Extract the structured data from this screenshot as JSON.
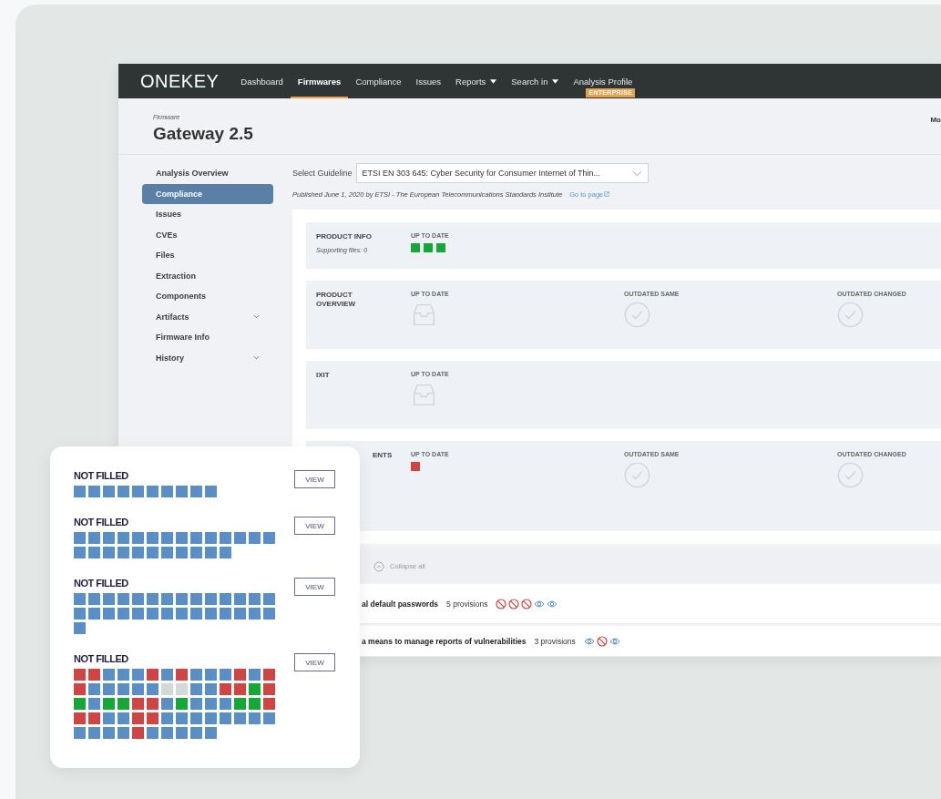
{
  "nav": {
    "logo": "ONEKEY",
    "items": [
      {
        "label": "Dashboard",
        "selected": false,
        "dropdown": false
      },
      {
        "label": "Firmwares",
        "selected": true,
        "dropdown": false
      },
      {
        "label": "Compliance",
        "selected": false,
        "dropdown": false
      },
      {
        "label": "Issues",
        "selected": false,
        "dropdown": false
      },
      {
        "label": "Reports",
        "selected": false,
        "dropdown": true
      },
      {
        "label": "Search in",
        "selected": false,
        "dropdown": true
      },
      {
        "label": "Analysis Profile",
        "selected": false,
        "dropdown": false,
        "badge": "ENTERPRISE"
      }
    ]
  },
  "header": {
    "caption": "Firmware",
    "title": "Gateway 2.5",
    "right_label": "Mo"
  },
  "sidebar": {
    "items": [
      {
        "label": "Analysis Overview",
        "selected": false,
        "expandable": false
      },
      {
        "label": "Compliance",
        "selected": true,
        "expandable": false
      },
      {
        "label": "Issues",
        "selected": false,
        "expandable": false
      },
      {
        "label": "CVEs",
        "selected": false,
        "expandable": false
      },
      {
        "label": "Files",
        "selected": false,
        "expandable": false
      },
      {
        "label": "Extraction",
        "selected": false,
        "expandable": false
      },
      {
        "label": "Components",
        "selected": false,
        "expandable": false
      },
      {
        "label": "Artifacts",
        "selected": false,
        "expandable": true
      },
      {
        "label": "Firmware Info",
        "selected": false,
        "expandable": false
      },
      {
        "label": "History",
        "selected": false,
        "expandable": true
      }
    ]
  },
  "guideline": {
    "label": "Select Guideline",
    "value": "ETSI EN 303 645: Cyber Security for Consumer Internet of Thin...",
    "published": "Published June 1, 2020 by ETSI - The European Telecommunications Standards Institute",
    "link": "Go to page"
  },
  "sections": [
    {
      "label": "PRODUCT INFO",
      "note": "Supporting files: 0",
      "columns": [
        {
          "label": "UP TO DATE",
          "kind": "squares",
          "cells": [
            {
              "color": "#16a836"
            },
            {
              "color": "#16a836"
            },
            {
              "color": "#16a836"
            }
          ]
        }
      ]
    },
    {
      "label": "PRODUCT OVERVIEW",
      "columns": [
        {
          "label": "UP TO DATE",
          "kind": "empty"
        },
        {
          "label": "OUTDATED SAME",
          "kind": "check"
        },
        {
          "label": "OUTDATED CHANGED",
          "kind": "check"
        }
      ]
    },
    {
      "label": "IXIT",
      "columns": [
        {
          "label": "UP TO DATE",
          "kind": "empty"
        }
      ]
    },
    {
      "label": "ENTS",
      "columns": [
        {
          "label": "UP TO DATE",
          "kind": "squares",
          "cells": [
            {
              "color": "#d14444"
            }
          ]
        },
        {
          "label": "OUTDATED SAME",
          "kind": "check"
        },
        {
          "label": "OUTDATED CHANGED",
          "kind": "check"
        }
      ]
    }
  ],
  "collapse": {
    "label": "Collapse all"
  },
  "provisions": [
    {
      "title": "al default passwords",
      "count": "5 provisions",
      "marks": [
        {
          "kind": "blocked"
        },
        {
          "kind": "blocked"
        },
        {
          "kind": "blocked"
        },
        {
          "kind": "visible"
        },
        {
          "kind": "visible"
        }
      ]
    },
    {
      "title": "a means to manage reports of vulnerabilities",
      "count": "3 provisions",
      "marks": [
        {
          "kind": "visible"
        },
        {
          "kind": "blocked"
        },
        {
          "kind": "visible"
        }
      ]
    }
  ],
  "overlay": {
    "groups": [
      {
        "title": "NOT FILLED",
        "button": "VIEW",
        "cells": [
          {
            "color": "#5a8fc6"
          },
          {
            "color": "#5a8fc6"
          },
          {
            "color": "#5a8fc6"
          },
          {
            "color": "#5a8fc6"
          },
          {
            "color": "#5a8fc6"
          },
          {
            "color": "#5a8fc6"
          },
          {
            "color": "#5a8fc6"
          },
          {
            "color": "#5a8fc6"
          },
          {
            "color": "#5a8fc6"
          },
          {
            "color": "#5a8fc6"
          }
        ]
      },
      {
        "title": "NOT FILLED",
        "button": "VIEW",
        "cells": [
          {
            "color": "#5a8fc6"
          },
          {
            "color": "#5a8fc6"
          },
          {
            "color": "#5a8fc6"
          },
          {
            "color": "#5a8fc6"
          },
          {
            "color": "#5a8fc6"
          },
          {
            "color": "#5a8fc6"
          },
          {
            "color": "#5a8fc6"
          },
          {
            "color": "#5a8fc6"
          },
          {
            "color": "#5a8fc6"
          },
          {
            "color": "#5a8fc6"
          },
          {
            "color": "#5a8fc6"
          },
          {
            "color": "#5a8fc6"
          },
          {
            "color": "#5a8fc6"
          },
          {
            "color": "#5a8fc6"
          },
          {
            "color": "#5a8fc6"
          },
          {
            "color": "#5a8fc6"
          },
          {
            "color": "#5a8fc6"
          },
          {
            "color": "#5a8fc6"
          },
          {
            "color": "#5a8fc6"
          },
          {
            "color": "#5a8fc6"
          },
          {
            "color": "#5a8fc6"
          },
          {
            "color": "#5a8fc6"
          },
          {
            "color": "#5a8fc6"
          },
          {
            "color": "#5a8fc6"
          },
          {
            "color": "#5a8fc6"
          }
        ]
      },
      {
        "title": "NOT FILLED",
        "button": "VIEW",
        "cells": [
          {
            "color": "#5a8fc6"
          },
          {
            "color": "#5a8fc6"
          },
          {
            "color": "#5a8fc6"
          },
          {
            "color": "#5a8fc6"
          },
          {
            "color": "#5a8fc6"
          },
          {
            "color": "#5a8fc6"
          },
          {
            "color": "#5a8fc6"
          },
          {
            "color": "#5a8fc6"
          },
          {
            "color": "#5a8fc6"
          },
          {
            "color": "#5a8fc6"
          },
          {
            "color": "#5a8fc6"
          },
          {
            "color": "#5a8fc6"
          },
          {
            "color": "#5a8fc6"
          },
          {
            "color": "#5a8fc6"
          },
          {
            "color": "#5a8fc6"
          },
          {
            "color": "#5a8fc6"
          },
          {
            "color": "#5a8fc6"
          },
          {
            "color": "#5a8fc6"
          },
          {
            "color": "#5a8fc6"
          },
          {
            "color": "#5a8fc6"
          },
          {
            "color": "#5a8fc6"
          },
          {
            "color": "#5a8fc6"
          },
          {
            "color": "#5a8fc6"
          },
          {
            "color": "#5a8fc6"
          },
          {
            "color": "#5a8fc6"
          },
          {
            "color": "#5a8fc6"
          },
          {
            "color": "#5a8fc6"
          },
          {
            "color": "#5a8fc6"
          },
          {
            "color": "#5a8fc6"
          }
        ]
      },
      {
        "title": "NOT FILLED",
        "button": "VIEW",
        "cells": [
          {
            "color": "#d14444"
          },
          {
            "color": "#d14444"
          },
          {
            "color": "#5a8fc6"
          },
          {
            "color": "#5a8fc6"
          },
          {
            "color": "#5a8fc6"
          },
          {
            "color": "#d14444"
          },
          {
            "color": "#5a8fc6"
          },
          {
            "color": "#d14444"
          },
          {
            "color": "#5a8fc6"
          },
          {
            "color": "#5a8fc6"
          },
          {
            "color": "#5a8fc6"
          },
          {
            "color": "#d14444"
          },
          {
            "color": "#5a8fc6"
          },
          {
            "color": "#d14444"
          },
          {
            "color": "#d14444"
          },
          {
            "color": "#5a8fc6"
          },
          {
            "color": "#5a8fc6"
          },
          {
            "color": "#5a8fc6"
          },
          {
            "color": "#5a8fc6"
          },
          {
            "color": "#5a8fc6"
          },
          {
            "color": "#d3d9d9"
          },
          {
            "color": "#d3d9d9"
          },
          {
            "color": "#5a8fc6"
          },
          {
            "color": "#5a8fc6"
          },
          {
            "color": "#d14444"
          },
          {
            "color": "#d14444"
          },
          {
            "color": "#16a836"
          },
          {
            "color": "#d14444"
          },
          {
            "color": "#16a836"
          },
          {
            "color": "#5a8fc6"
          },
          {
            "color": "#16a836"
          },
          {
            "color": "#16a836"
          },
          {
            "color": "#d14444"
          },
          {
            "color": "#d14444"
          },
          {
            "color": "#5a8fc6"
          },
          {
            "color": "#16a836"
          },
          {
            "color": "#5a8fc6"
          },
          {
            "color": "#5a8fc6"
          },
          {
            "color": "#5a8fc6"
          },
          {
            "color": "#16a836"
          },
          {
            "color": "#16a836"
          },
          {
            "color": "#d14444"
          },
          {
            "color": "#d14444"
          },
          {
            "color": "#d14444"
          },
          {
            "color": "#5a8fc6"
          },
          {
            "color": "#5a8fc6"
          },
          {
            "color": "#d14444"
          },
          {
            "color": "#d14444"
          },
          {
            "color": "#5a8fc6"
          },
          {
            "color": "#5a8fc6"
          },
          {
            "color": "#5a8fc6"
          },
          {
            "color": "#5a8fc6"
          },
          {
            "color": "#5a8fc6"
          },
          {
            "color": "#5a8fc6"
          },
          {
            "color": "#5a8fc6"
          },
          {
            "color": "#5a8fc6"
          },
          {
            "color": "#5a8fc6"
          },
          {
            "color": "#5a8fc6"
          },
          {
            "color": "#5a8fc6"
          },
          {
            "color": "#5a8fc6"
          },
          {
            "color": "#d14444"
          },
          {
            "color": "#5a8fc6"
          },
          {
            "color": "#5a8fc6"
          },
          {
            "color": "#5a8fc6"
          },
          {
            "color": "#5a8fc6"
          },
          {
            "color": "#5a8fc6"
          }
        ]
      }
    ]
  }
}
